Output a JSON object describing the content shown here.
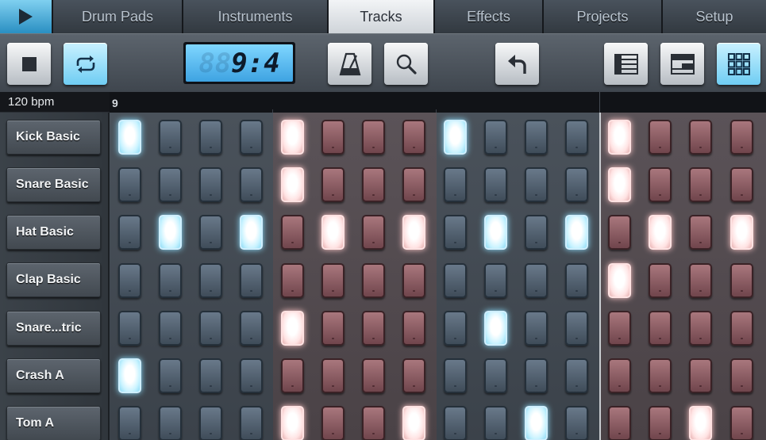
{
  "tabs": [
    {
      "key": "play",
      "label": ""
    },
    {
      "key": "drum_pads",
      "label": "Drum Pads"
    },
    {
      "key": "instruments",
      "label": "Instruments"
    },
    {
      "key": "tracks",
      "label": "Tracks"
    },
    {
      "key": "effects",
      "label": "Effects"
    },
    {
      "key": "projects",
      "label": "Projects"
    },
    {
      "key": "setup",
      "label": "Setup"
    }
  ],
  "active_tab": "Tracks",
  "toolbar": {
    "stop_icon": "stop-icon",
    "loop_icon": "loop-icon",
    "metronome_icon": "metronome-icon",
    "zoom_icon": "magnifier-icon",
    "undo_icon": "undo-icon",
    "view_icons": [
      "list-view-icon",
      "split-view-icon",
      "grid-view-icon"
    ]
  },
  "position_display": {
    "ghost": "88",
    "time": "9:4"
  },
  "tempo": "120 bpm",
  "ruler": {
    "bar_label": "9"
  },
  "colors": {
    "accent": "#6fcdf3",
    "pad_off_blue": "#4f5e6d",
    "pad_off_red": "#8b5a60",
    "pad_on": "#ffffff"
  },
  "tracks": [
    {
      "name": "Kick Basic",
      "steps": [
        1,
        0,
        0,
        0,
        1,
        0,
        0,
        0,
        1,
        0,
        0,
        0,
        1,
        0,
        0,
        0
      ]
    },
    {
      "name": "Snare Basic",
      "steps": [
        0,
        0,
        0,
        0,
        1,
        0,
        0,
        0,
        0,
        0,
        0,
        0,
        1,
        0,
        0,
        0
      ]
    },
    {
      "name": "Hat Basic",
      "steps": [
        0,
        1,
        0,
        1,
        0,
        1,
        0,
        1,
        0,
        1,
        0,
        1,
        0,
        1,
        0,
        1
      ]
    },
    {
      "name": "Clap Basic",
      "steps": [
        0,
        0,
        0,
        0,
        0,
        0,
        0,
        0,
        0,
        0,
        0,
        0,
        1,
        0,
        0,
        0
      ]
    },
    {
      "name": "Snare...tric",
      "steps": [
        0,
        0,
        0,
        0,
        1,
        0,
        0,
        0,
        0,
        1,
        0,
        0,
        0,
        0,
        0,
        0
      ]
    },
    {
      "name": "Crash A",
      "steps": [
        1,
        0,
        0,
        0,
        0,
        0,
        0,
        0,
        0,
        0,
        0,
        0,
        0,
        0,
        0,
        0
      ]
    },
    {
      "name": "Tom A",
      "steps": [
        0,
        0,
        0,
        0,
        1,
        0,
        0,
        1,
        0,
        0,
        1,
        0,
        0,
        0,
        1,
        0
      ]
    }
  ]
}
